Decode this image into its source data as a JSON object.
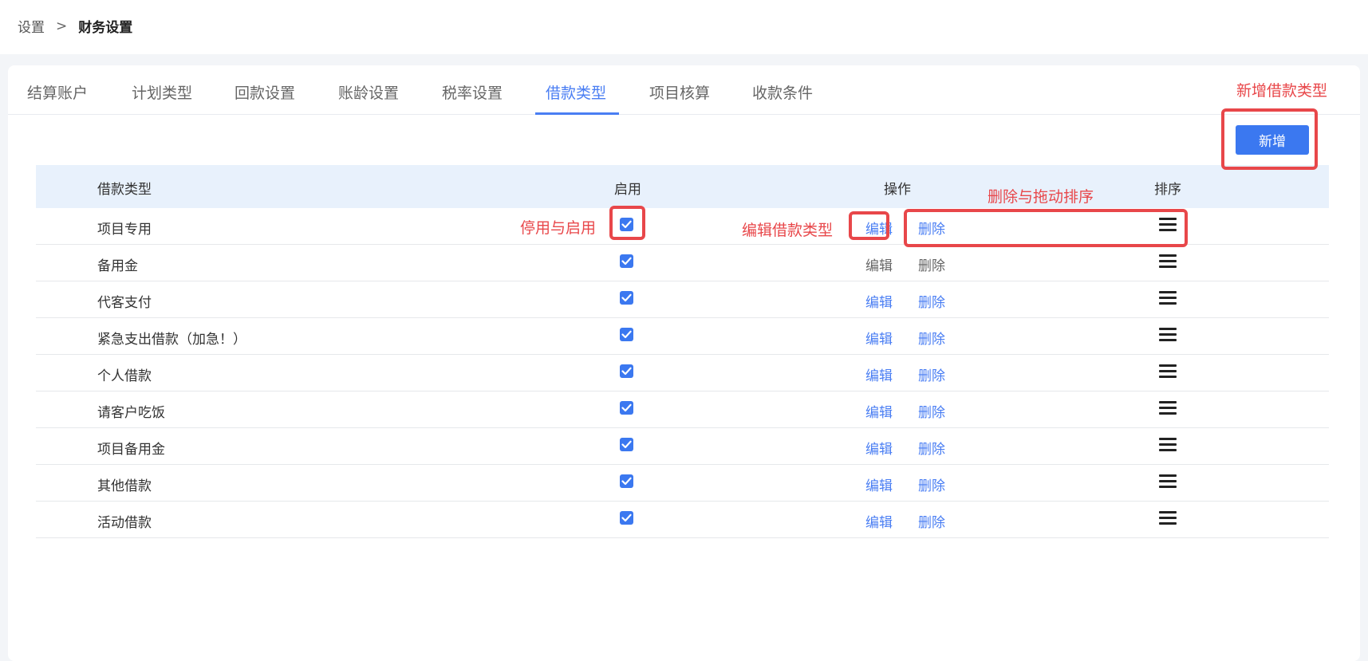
{
  "breadcrumb": {
    "parent": "设置",
    "separator": ">",
    "current": "财务设置"
  },
  "tabs": [
    {
      "label": "结算账户"
    },
    {
      "label": "计划类型"
    },
    {
      "label": "回款设置"
    },
    {
      "label": "账龄设置"
    },
    {
      "label": "税率设置"
    },
    {
      "label": "借款类型",
      "active": true
    },
    {
      "label": "项目核算"
    },
    {
      "label": "收款条件"
    }
  ],
  "toolbar": {
    "add_label": "新增"
  },
  "table": {
    "headers": {
      "name": "借款类型",
      "enabled": "启用",
      "actions": "操作",
      "sort": "排序"
    },
    "rows": [
      {
        "name": "项目专用",
        "enabled": true,
        "edit": "编辑",
        "delete": "删除"
      },
      {
        "name": "备用金",
        "enabled": true,
        "edit": "编辑",
        "delete": "删除",
        "actions_disabled": true
      },
      {
        "name": "代客支付",
        "enabled": true,
        "edit": "编辑",
        "delete": "删除"
      },
      {
        "name": "紧急支出借款（加急！）",
        "enabled": true,
        "edit": "编辑",
        "delete": "删除"
      },
      {
        "name": "个人借款",
        "enabled": true,
        "edit": "编辑",
        "delete": "删除"
      },
      {
        "name": "请客户吃饭",
        "enabled": true,
        "edit": "编辑",
        "delete": "删除"
      },
      {
        "name": "项目备用金",
        "enabled": true,
        "edit": "编辑",
        "delete": "删除"
      },
      {
        "name": "其他借款",
        "enabled": true,
        "edit": "编辑",
        "delete": "删除"
      },
      {
        "name": "活动借款",
        "enabled": true,
        "edit": "编辑",
        "delete": "删除"
      }
    ]
  },
  "annotations": {
    "add": "新增借款类型",
    "toggle": "停用与启用",
    "edit": "编辑借款类型",
    "delete_sort": "删除与拖动排序"
  },
  "colors": {
    "accent": "#3b78f0",
    "link": "#4a7ef3",
    "annotation": "#e8474a",
    "header_bg": "#e8f1fc"
  },
  "icons": {
    "sort": "drag-handle-icon",
    "check": "checkbox-checked-icon"
  }
}
